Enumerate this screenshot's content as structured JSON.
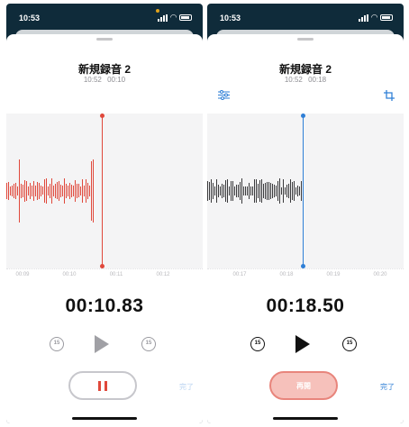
{
  "screens": [
    {
      "status_time": "10:53",
      "title": "新規録音 2",
      "meta_time": "10:52",
      "meta_duration": "00:10",
      "timer": "00:10.83",
      "skip_back_label": "15",
      "skip_fwd_label": "15",
      "done_label": "完了",
      "tick_labels": [
        "00:09",
        "00:10",
        "00:11",
        "00:12"
      ],
      "colors": {
        "waveform": "#e0483b",
        "playhead": "#e0483b"
      },
      "icons": [
        "skip-back-15-icon",
        "play-icon",
        "skip-forward-15-icon",
        "pause-icon"
      ]
    },
    {
      "status_time": "10:53",
      "title": "新規録音 2",
      "meta_time": "10:52",
      "meta_duration": "00:18",
      "timer": "00:18.50",
      "skip_back_label": "15",
      "skip_fwd_label": "15",
      "done_label": "完了",
      "resume_label": "再開",
      "tick_labels": [
        "00:17",
        "00:18",
        "00:19",
        "00:20"
      ],
      "colors": {
        "waveform": "#3a3a3c",
        "playhead": "#2f7fd6"
      },
      "icons": [
        "options-icon",
        "trim-icon",
        "skip-back-15-icon",
        "play-icon",
        "skip-forward-15-icon"
      ]
    }
  ]
}
